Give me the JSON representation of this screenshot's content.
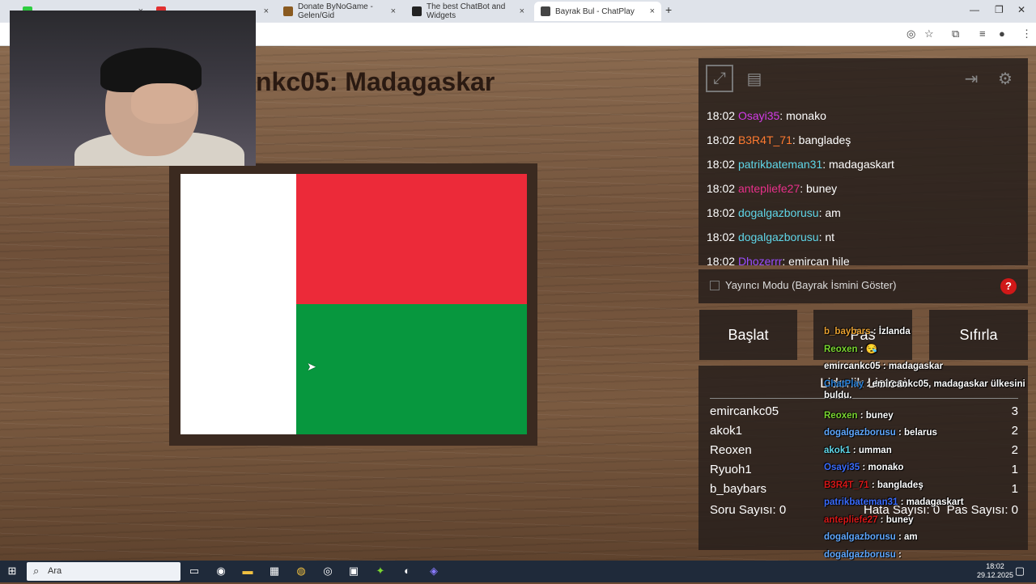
{
  "browser": {
    "tabs": [
      {
        "label": "",
        "active": false
      },
      {
        "label": "",
        "active": false
      },
      {
        "label": "Donate ByNoGame - Gelen/Gid",
        "active": false
      },
      {
        "label": "The best ChatBot and Widgets",
        "active": false
      },
      {
        "label": "Bayrak Bul - ChatPlay",
        "active": true
      }
    ],
    "new_tab": "+",
    "close": "×"
  },
  "game": {
    "question": "nkc05: Madagaskar",
    "flag_colors": {
      "white": "#ffffff",
      "red": "#ec2a39",
      "green": "#07973e"
    }
  },
  "chat": {
    "messages": [
      {
        "time": "18:02",
        "user": "Osayi35",
        "color": "#d33be8",
        "text": ": monako"
      },
      {
        "time": "18:02",
        "user": "B3R4T_71",
        "color": "#ff7a30",
        "text": ": bangladeş"
      },
      {
        "time": "18:02",
        "user": "patrikbateman31",
        "color": "#5fd6e8",
        "text": ": madagaskart"
      },
      {
        "time": "18:02",
        "user": "antepliefe27",
        "color": "#e8308a",
        "text": ": buney"
      },
      {
        "time": "18:02",
        "user": "dogalgazborusu",
        "color": "#5fd6e8",
        "text": ": am"
      },
      {
        "time": "18:02",
        "user": "dogalgazborusu",
        "color": "#5fd6e8",
        "text": ": nt"
      },
      {
        "time": "18:02",
        "user": "Dhozerrr",
        "color": "#9b4dff",
        "text": ": emircan hile"
      }
    ],
    "streamer_mode_label": "Yayıncı Modu (Bayrak İsmini Göster)",
    "help": "?"
  },
  "buttons": {
    "start": "Başlat",
    "pass": "Pas",
    "reset": "Sıfırla"
  },
  "leaderboard": {
    "title": "Liderlik Listesi",
    "rows": [
      {
        "name": "emircankc05",
        "score": "3"
      },
      {
        "name": "akok1",
        "score": "2"
      },
      {
        "name": "Reoxen",
        "score": "2"
      },
      {
        "name": "Ryuoh1",
        "score": "1"
      },
      {
        "name": "b_baybars",
        "score": "1"
      }
    ],
    "questions": "Soru Sayısı: 0",
    "errors": "Hata Sayısı: 0",
    "passes": "Pas Sayısı: 0"
  },
  "overlay_chat": [
    {
      "user": "b_baybars",
      "color": "#e8a030",
      "text": " : İzlanda"
    },
    {
      "user": "Reoxen",
      "color": "#7ad630",
      "text": " : 😪"
    },
    {
      "user": "emircankc05",
      "color": "#ffffff",
      "text": " : madagaskar"
    },
    {
      "user": "ChatPlay",
      "color": "#2a7fd4",
      "text": " : emircankc05, madagaskar ülkesini buldu."
    },
    {
      "user": "Reoxen",
      "color": "#7ad630",
      "text": " : buney"
    },
    {
      "user": "dogalgazborusu",
      "color": "#5fa8ff",
      "text": " : belarus"
    },
    {
      "user": "akok1",
      "color": "#5fd6e8",
      "text": " : umman"
    },
    {
      "user": "Osayi35",
      "color": "#3a6cff",
      "text": " : monako"
    },
    {
      "user": "B3R4T_71",
      "color": "#d81818",
      "text": " : bangladeş"
    },
    {
      "user": "patrikbateman31",
      "color": "#3a6cff",
      "text": " : madagaskart"
    },
    {
      "user": "antepliefe27",
      "color": "#d81818",
      "text": " : buney"
    },
    {
      "user": "dogalgazborusu",
      "color": "#5fa8ff",
      "text": " : am"
    },
    {
      "user": "dogalgazborusu",
      "color": "#5fa8ff",
      "text": " : "
    },
    {
      "user": "Dhozerrr",
      "color": "#9b4dff",
      "text": " : emircan hile"
    }
  ],
  "taskbar": {
    "search_placeholder": "Ara",
    "time": "18:02",
    "date": "29.12.2025"
  }
}
